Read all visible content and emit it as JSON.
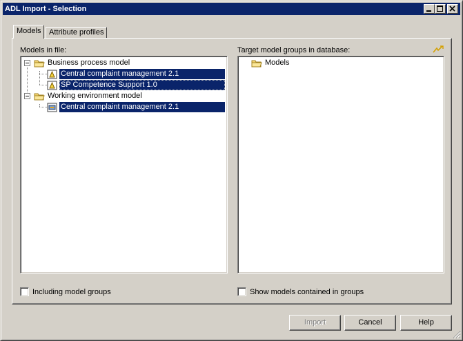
{
  "window": {
    "title": "ADL Import - Selection"
  },
  "tabs": [
    {
      "label": "Models",
      "active": true
    },
    {
      "label": "Attribute profiles",
      "active": false
    }
  ],
  "left_panel": {
    "label": "Models in file:",
    "tree": [
      {
        "label": "Business process model",
        "icon": "folder-icon",
        "children": [
          {
            "label": "Central complaint management 2.1",
            "icon": "process-model-icon",
            "selected": true
          },
          {
            "label": "SP Competence Support 1.0",
            "icon": "process-model-icon",
            "selected": true
          }
        ]
      },
      {
        "label": "Working environment model",
        "icon": "folder-icon",
        "children": [
          {
            "label": "Central complaint management 2.1",
            "icon": "environment-model-icon",
            "selected": true
          }
        ]
      }
    ],
    "checkbox_label": "Including model groups",
    "checkbox_checked": false
  },
  "right_panel": {
    "label": "Target model groups in database:",
    "tree": [
      {
        "label": "Models",
        "icon": "folder-icon"
      }
    ],
    "checkbox_label": "Show models contained in groups",
    "checkbox_checked": false,
    "corner_icon": "lightning-icon"
  },
  "buttons": {
    "import": "Import",
    "cancel": "Cancel",
    "help": "Help"
  },
  "colors": {
    "titlebar": "#0a246a",
    "selection": "#0a246a",
    "face": "#d4d0c8"
  }
}
